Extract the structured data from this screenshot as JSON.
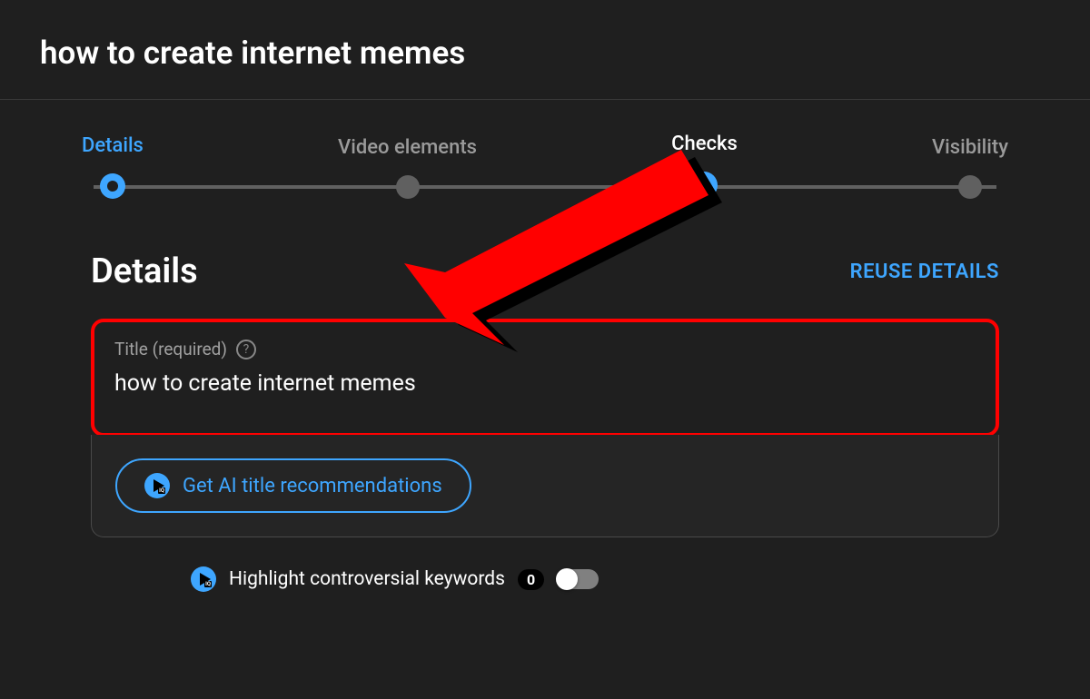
{
  "header": {
    "title": "how to create internet memes"
  },
  "stepper": {
    "steps": [
      {
        "label": "Details",
        "state": "active"
      },
      {
        "label": "Video elements",
        "state": "muted"
      },
      {
        "label": "Checks",
        "state": "check"
      },
      {
        "label": "Visibility",
        "state": "muted"
      }
    ]
  },
  "details": {
    "heading": "Details",
    "reuse_label": "REUSE DETAILS",
    "title_field_label": "Title (required)",
    "title_value": "how to create internet memes",
    "help_char": "?",
    "ai_button_label": "Get AI title recommendations"
  },
  "highlight": {
    "label": "Highlight controversial keywords",
    "count": "0",
    "toggle_on": false
  },
  "annotation": {
    "arrow_color": "#ff0000"
  }
}
